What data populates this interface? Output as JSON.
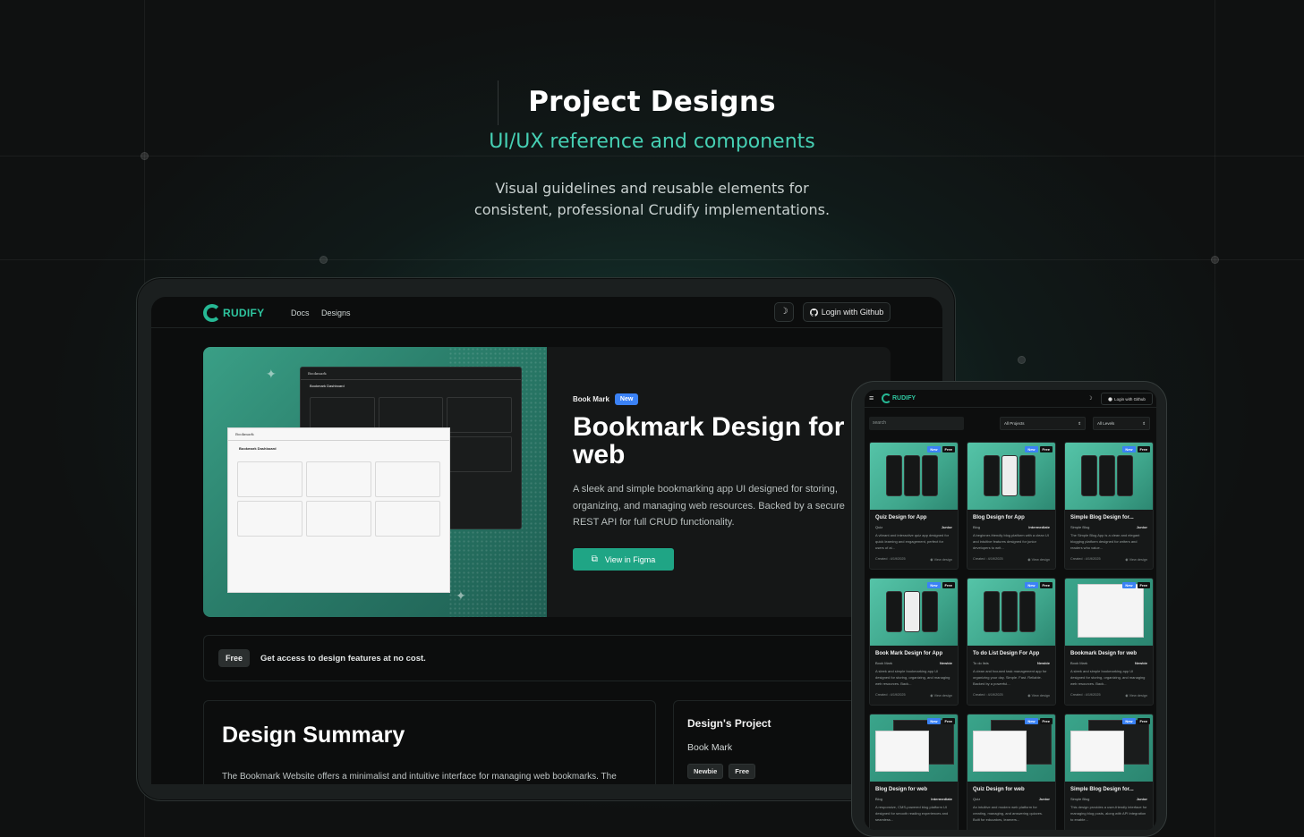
{
  "hero": {
    "title": "Project Designs",
    "subtitle": "UI/UX reference and components",
    "desc_line1": "Visual guidelines and reusable elements for",
    "desc_line2": "consistent, professional Crudify implementations."
  },
  "laptop": {
    "logo_text": "RUDIFY",
    "nav": [
      "Docs",
      "Designs"
    ],
    "theme_icon": "☽",
    "login_label": "Login with Github",
    "feature": {
      "category": "Book Mark",
      "badge": "New",
      "title": "Bookmark Design for web",
      "description": "A sleek and simple bookmarking app UI designed for storing, organizing, and managing web resources. Backed by a secure REST API for full CRUD functionality.",
      "button_label": "View in Figma",
      "mock_title": "Bookmark",
      "mock_heading": "Bookmark Dashboard"
    },
    "free_bar": {
      "pill": "Free",
      "text": "Get access to design features at no cost."
    },
    "summary": {
      "title": "Design Summary",
      "text": "The Bookmark Website offers a minimalist and intuitive interface for managing web bookmarks. The layout emphasizes clarity, usability, and quick interactions—perfect for storing and organizing useful links. The UI"
    },
    "project": {
      "heading": "Design's Project",
      "name": "Book Mark",
      "tags": [
        "Newbie",
        "Free"
      ]
    }
  },
  "tablet": {
    "menu_icon": "≡",
    "logo_text": "RUDIFY",
    "login_label": "Login with Github",
    "search_placeholder": "search",
    "filter_projects": "All Projects",
    "filter_levels": "All Levels",
    "view_label": "View design",
    "cards": [
      {
        "title": "Quiz Design for App",
        "category": "Quiz",
        "level": "Junior",
        "desc": "A vibrant and interactive quiz app designed for quick learning and engagement, perfect for users of al...",
        "created": "Created : 4/19/2025",
        "new": "New",
        "free": "Free",
        "kind": "app-dark"
      },
      {
        "title": "Blog Design for App",
        "category": "Blog",
        "level": "Intermediate",
        "desc": "A beginner-friendly blog platform with a clean UI and intuitive features designed for junior developers to writ...",
        "created": "Created : 4/19/2025",
        "new": "New",
        "free": "Free",
        "kind": "app-mixed"
      },
      {
        "title": "Simple Blog Design for...",
        "category": "Simple Blog",
        "level": "Junior",
        "desc": "The Simple Blog App is a clean and elegant blogging platform designed for writers and readers who value...",
        "created": "Created : 4/19/2025",
        "new": "New",
        "free": "Free",
        "kind": "app-dark"
      },
      {
        "title": "Book Mark Design for App",
        "category": "Book Mark",
        "level": "Newbie",
        "desc": "A sleek and simple bookmarking app UI designed for storing, organizing, and managing web resources. Back...",
        "created": "Created : 4/19/2025",
        "new": "New",
        "free": "Free",
        "kind": "app-mixed"
      },
      {
        "title": "To do List Design For App",
        "category": "To do lists",
        "level": "Newbie",
        "desc": "A clean and focused task management app for organizing your day. Simple. Fast. Reliable. Backed by a powerful...",
        "created": "Created : 4/19/2025",
        "new": "New",
        "free": "Free",
        "kind": "app-dark"
      },
      {
        "title": "Bookmark Design for web",
        "category": "Book Mark",
        "level": "Newbie",
        "desc": "A sleek and simple bookmarking app UI designed for storing, organizing, and managing web resources. Back...",
        "created": "Created : 4/19/2025",
        "new": "New",
        "free": "Free",
        "kind": "web"
      },
      {
        "title": "Blog Design for web",
        "category": "Blog",
        "level": "Intermediate",
        "desc": "A responsive, CMS-powered blog platform UI designed for smooth reading experiences and seamless...",
        "created": "",
        "new": "New",
        "free": "Free",
        "kind": "web"
      },
      {
        "title": "Quiz Design for web",
        "category": "Quiz",
        "level": "Junior",
        "desc": "An intuitive and modern web platform for creating, managing, and answering quizzes. Built for educators, learners...",
        "created": "",
        "new": "New",
        "free": "Free",
        "kind": "web"
      },
      {
        "title": "Simple Blog Design for...",
        "category": "Simple Blog",
        "level": "Junior",
        "desc": "This design provides a user-friendly interface for managing blog posts, along with API integration to enable...",
        "created": "",
        "new": "New",
        "free": "Free",
        "kind": "web"
      }
    ]
  },
  "colors": {
    "accent": "#1fa585",
    "brand": "#2ec59f",
    "badge_new": "#3b82f6",
    "hero_subtitle": "#46d0b4"
  }
}
